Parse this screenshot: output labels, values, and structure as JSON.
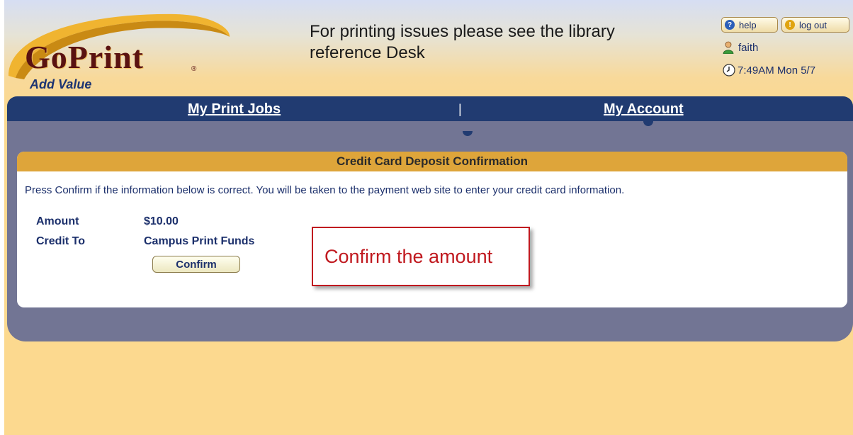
{
  "logo": {
    "brand": "GoPrint",
    "registered_mark": "®",
    "subtitle": "Add Value"
  },
  "header": {
    "notice": "For printing issues please see the library reference Desk",
    "help_label": "help",
    "logout_label": "log out",
    "username": "faith",
    "clock": "7:49AM Mon 5/7"
  },
  "nav": {
    "my_print_jobs": "My Print Jobs",
    "separator": "|",
    "my_account": "My Account"
  },
  "panel": {
    "title": "Credit Card Deposit Confirmation",
    "description": "Press Confirm if the information below is correct. You will be taken to the payment web site to enter your credit card information.",
    "amount_label": "Amount",
    "amount_value": "$10.00",
    "credit_label": "Credit To",
    "credit_value": "Campus Print Funds",
    "confirm_label": "Confirm"
  },
  "callout": {
    "text": "Confirm the amount"
  },
  "colors": {
    "nav_bg": "#213b71",
    "frame_bg": "#727594",
    "panel_header": "#dea53a",
    "callout_red": "#c0191f",
    "text_blue": "#1b2f6b",
    "logo_maroon": "#5a1211"
  },
  "icons": {
    "help": "help-icon",
    "logout": "power-icon",
    "user": "user-icon",
    "clock": "clock-icon"
  }
}
